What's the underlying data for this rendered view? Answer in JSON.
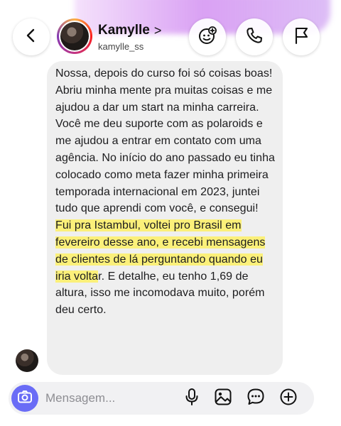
{
  "header": {
    "contact_name": "Kamylle",
    "name_chevron": ">",
    "handle": "kamylle_ss",
    "icons": [
      "back-arrow-icon",
      "add-sticker-face-icon",
      "phone-icon",
      "flag-icon"
    ]
  },
  "message": {
    "segments": [
      {
        "text": "Nossa, depois do curso foi só coisas boas! Abriu minha mente pra muitas coisas e me ajudou a dar um start na minha carreira. Você me deu suporte com as polaroids e me ajudou a entrar em contato com uma agência. No início do ano passado eu tinha colocado como meta fazer minha primeira temporada internacional em 2023, juntei tudo que aprendi com você, e consegui! ",
        "highlight": false
      },
      {
        "text": "Fui pra Istambul, voltei pro Brasil em fevereiro desse ano, e recebi mensagens de clientes de lá perguntando quando eu iria volta",
        "highlight": true
      },
      {
        "text": "r. E detalhe, eu tenho 1,69 de altura, isso me incomodava muito, porém deu certo.",
        "highlight": false
      }
    ],
    "highlight_color": "#fbf07a"
  },
  "composer": {
    "placeholder": "Mensagem...",
    "camera_color": "#6a6cf6",
    "icons": [
      "camera-icon",
      "microphone-icon",
      "gallery-icon",
      "chat-sticker-icon",
      "add-icon"
    ]
  }
}
